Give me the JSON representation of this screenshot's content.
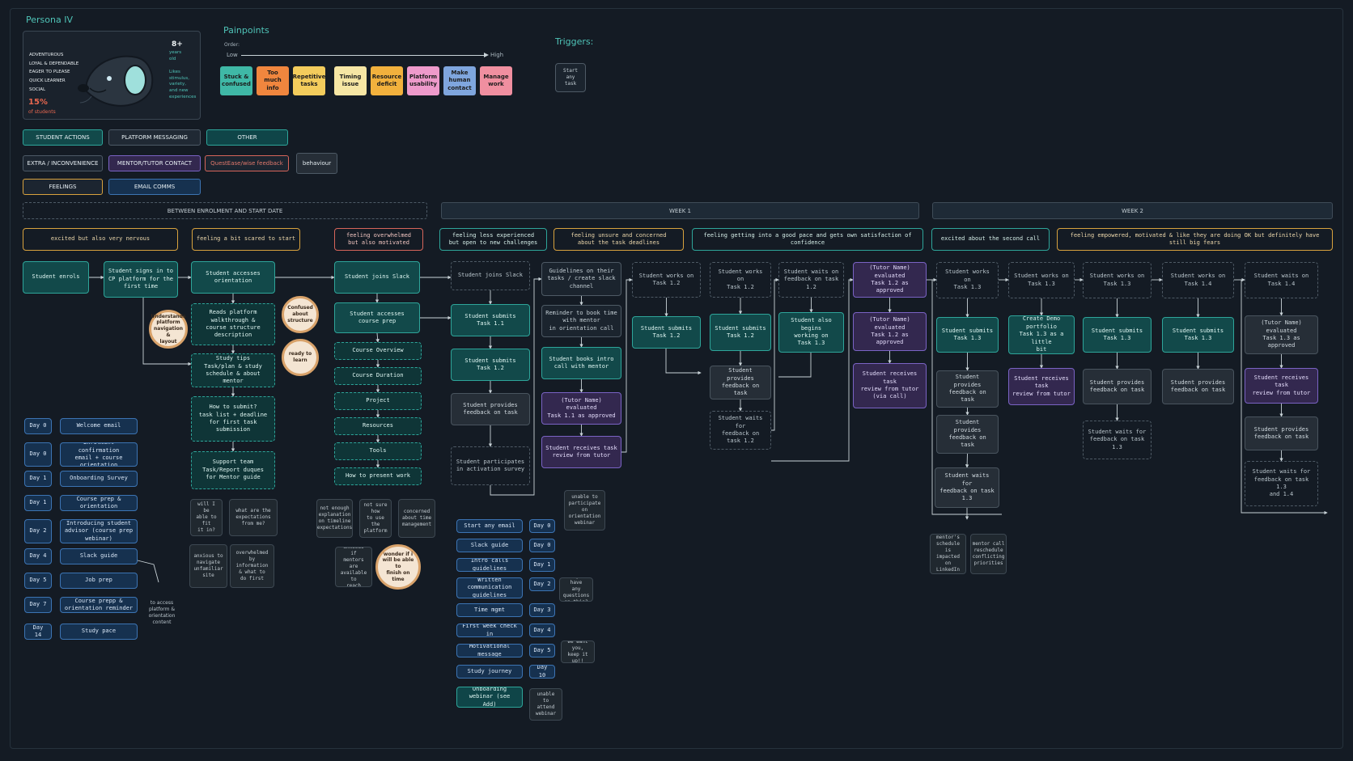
{
  "persona": {
    "title": "Persona IV",
    "traits": "ADVENTUROUS\nLOYAL & DEPENDABLE\nEAGER TO PLEASE\nQUICK LEARNER\nSOCIAL",
    "age_value": "8+",
    "age_label": "years\nold",
    "likes": "Likes\nstimulus,\nvariety,\nand new\nexperiences",
    "percent": "15%",
    "percent_label": "of students"
  },
  "painpoints": {
    "title": "Painpoints",
    "order_label": "Order:",
    "low": "Low",
    "high": "High",
    "items": [
      {
        "label": "Stuck &\nconfused",
        "color": "#3fb8a6"
      },
      {
        "label": "Too\nmuch\ninfo",
        "color": "#f0863e"
      },
      {
        "label": "Repetitive\ntasks",
        "color": "#f3cc5c"
      },
      {
        "label": "Timing\nissue",
        "color": "#f6e6a4"
      },
      {
        "label": "Resource\ndeficit",
        "color": "#f2b13d"
      },
      {
        "label": "Platform\nusability",
        "color": "#ee9acb"
      },
      {
        "label": "Make\nhuman\ncontact",
        "color": "#7fa6de"
      },
      {
        "label": "Manage\nwork",
        "color": "#f08fa0"
      }
    ]
  },
  "triggers": {
    "title": "Triggers:",
    "item": "Start\nany\ntask"
  },
  "legend": [
    {
      "label": "STUDENT ACTIONS",
      "bg": "#12494a",
      "border": "#2ea59a"
    },
    {
      "label": "PLATFORM MESSAGING",
      "bg": "#202934",
      "border": "#4d5a66"
    },
    {
      "label": "OTHER",
      "bg": "#0f4548",
      "border": "#2ea59a"
    },
    {
      "label": "EXTRA / INCONVENIENCE",
      "bg": "#1c2530",
      "border": "#4d5a66"
    },
    {
      "label": "MENTOR/TUTOR CONTACT",
      "bg": "#33284f",
      "border": "#7a63c4"
    },
    {
      "label": "QuestEase/wise feedback",
      "bg": "#1c2530",
      "border": "#d6655a"
    },
    {
      "label": "behaviour",
      "bg": "#262e37",
      "border": "#4d5a66"
    },
    {
      "label": "FEELINGS",
      "bg": "#1c2530",
      "border": "#d8a23e"
    },
    {
      "label": "EMAIL COMMS",
      "bg": "#16314f",
      "border": "#3c74b3"
    }
  ],
  "phases": [
    {
      "label": "BETWEEN ENROLMENT AND START DATE"
    },
    {
      "label": "WEEK 1"
    },
    {
      "label": "WEEK 2"
    }
  ],
  "feelings": [
    {
      "label": "excited but also very nervous",
      "tone": "f"
    },
    {
      "label": "feeling a bit scared to start",
      "tone": "f"
    },
    {
      "label": "feeling overwhelmed\nbut also motivated",
      "tone": "fr"
    },
    {
      "label": "feeling less experienced\nbut open to new challenges",
      "tone": "fg"
    },
    {
      "label": "feeling unsure and concerned\nabout the task deadlines",
      "tone": "f"
    },
    {
      "label": "feeling getting into a good pace and gets own satisfaction of confidence",
      "tone": "fg"
    },
    {
      "label": "excited about the second call",
      "tone": "fg"
    },
    {
      "label": "feeling empowered, motivated & like they are doing OK but definitely have still big fears",
      "tone": "f"
    }
  ],
  "nodes": [
    {
      "text": "Student enrols",
      "s": "g"
    },
    {
      "text": "Student signs in to\nCP platform for the\nfirst time",
      "s": "g"
    },
    {
      "text": "Student accesses\norientation",
      "s": "g"
    },
    {
      "text": "Reads platform\nwalkthrough &\ncourse structure\ndescription",
      "s": "gd"
    },
    {
      "text": "Study tips\nTask/plan & study\nschedule & about mentor",
      "s": "gd"
    },
    {
      "text": "How to submit?\ntask list + deadline\nfor first task\nsubmission",
      "s": "gd"
    },
    {
      "text": "Support team\nTask/Report duques\nfor Mentor guide",
      "s": "gd"
    },
    {
      "text": "Student joins Slack",
      "s": "g"
    },
    {
      "text": "Student accesses\ncourse prep",
      "s": "g"
    },
    {
      "text": "Course Overview",
      "s": "gd"
    },
    {
      "text": "Course Duration",
      "s": "gd"
    },
    {
      "text": "Project",
      "s": "gd"
    },
    {
      "text": "Resources",
      "s": "gd"
    },
    {
      "text": "Tools",
      "s": "gd"
    },
    {
      "text": "How to present work",
      "s": "gd"
    },
    {
      "text": "Student joins Slack",
      "s": "ph"
    },
    {
      "text": "Student submits\nTask 1.1",
      "s": "g"
    },
    {
      "text": "Student submits\nTask 1.2",
      "s": "g"
    },
    {
      "text": "Student provides\nfeedback on task",
      "s": "gr"
    },
    {
      "text": "Student participates\nin activation survey",
      "s": "ph"
    },
    {
      "text": "Guidelines on their\ntasks / create slack\nchannel",
      "s": "phs"
    },
    {
      "text": "Reminder to book time\nwith mentor\nin orientation call",
      "s": "phs"
    },
    {
      "text": "Student books intro\ncall with mentor",
      "s": "g"
    },
    {
      "text": "(Tutor Name) evaluated\nTask 1.1 as approved",
      "s": "p"
    },
    {
      "text": "Student receives task\nreview from tutor",
      "s": "p"
    },
    {
      "text": "Student works on\nTask 1.2",
      "s": "ph"
    },
    {
      "text": "Student submits\nTask 1.2",
      "s": "g"
    },
    {
      "text": "Student works on\nTask 1.2",
      "s": "ph"
    },
    {
      "text": "Student submits\nTask 1.2",
      "s": "g"
    },
    {
      "text": "Student provides\nfeedback on task",
      "s": "gr"
    },
    {
      "text": "Student waits for\nfeedback on task 1.2",
      "s": "ph"
    },
    {
      "text": "Student waits on\nfeedback on task 1.2",
      "s": "ph"
    },
    {
      "text": "Student also begins\nworking on\nTask 1.3",
      "s": "g"
    },
    {
      "text": "(Tutor Name) evaluated\nTask 1.2 as approved",
      "s": "p"
    },
    {
      "text": "(Tutor Name) evaluated\nTask 1.2 as approved",
      "s": "p"
    },
    {
      "text": "Student receives task\nreview from tutor\n(via call)",
      "s": "p"
    },
    {
      "text": "Student works on\nTask 1.3",
      "s": "ph"
    },
    {
      "text": "Student submits\nTask 1.3",
      "s": "g"
    },
    {
      "text": "Student provides\nfeedback on task",
      "s": "gr"
    },
    {
      "text": "Student provides\nfeedback on task",
      "s": "gr"
    },
    {
      "text": "Student waits for\nfeedback on task 1.3",
      "s": "gr"
    },
    {
      "text": "Student works on\nTask 1.3",
      "s": "ph"
    },
    {
      "text": "Create Demo portfolio\nTask 1.3 as a little\nbit",
      "s": "g"
    },
    {
      "text": "Student receives task\nreview from tutor",
      "s": "p"
    },
    {
      "text": "Student works on\nTask 1.3",
      "s": "ph"
    },
    {
      "text": "Student submits\nTask 1.3",
      "s": "g"
    },
    {
      "text": "Student provides\nfeedback on task",
      "s": "gr"
    },
    {
      "text": "Student waits for\nfeedback on task 1.3",
      "s": "ph"
    },
    {
      "text": "Student works on\nTask 1.4",
      "s": "ph"
    },
    {
      "text": "Student submits\nTask 1.3",
      "s": "g"
    },
    {
      "text": "Student provides\nfeedback on task",
      "s": "gr"
    },
    {
      "text": "Student waits on\nTask 1.4",
      "s": "ph"
    },
    {
      "text": "(Tutor Name) evaluated\nTask 1.3 as approved",
      "s": "gr"
    },
    {
      "text": "Student receives task\nreview from tutor",
      "s": "p"
    },
    {
      "text": "Student provides\nfeedback on task",
      "s": "gr"
    },
    {
      "text": "Student waits for\nfeedback on task 1.3\nand 1.4",
      "s": "ph"
    }
  ],
  "bubbles": [
    {
      "text": "Understands\nplatform\nnavigation &\nlayout"
    },
    {
      "text": "Confused\nabout\nstructure"
    },
    {
      "text": "ready to\nlearn"
    },
    {
      "text": "wonder if i\nwill be able to\nfinish on\ntime"
    }
  ],
  "thoughts": [
    {
      "text": "will I be\nable to fit\nit in?"
    },
    {
      "text": "what are the\nexpectations\nfrom me?"
    },
    {
      "text": "anxious to\nnavigate\nunfamiliar\nsite"
    },
    {
      "text": "overwhelmed\nby information\n& what to\ndo first"
    },
    {
      "text": "not enough\nexplanation\non timeline\nexpectations"
    },
    {
      "text": "not sure how\nto use the\nplatform"
    },
    {
      "text": "concerned\nabout time\nmanagement"
    },
    {
      "text": "anxious if\nmentors are\navailable to\nreach"
    },
    {
      "text": "unable to\nparticipate on\norientation\nwebinar"
    },
    {
      "text": "do you have\nany questions\non this?"
    },
    {
      "text": "we want\nyou, keep it\nup!!"
    },
    {
      "text": "unable to\nattend\nwebinar"
    },
    {
      "text": "mentor's\nschedule\nis impacted\non LinkedIn"
    },
    {
      "text": "mentor call\nreschedule\nconflicting\npriorities"
    }
  ],
  "email_comms": [
    {
      "day": "Day 0",
      "label": "Welcome email"
    },
    {
      "day": "Day 0",
      "label": "Enrolment confirmation\nemail + course\norientation"
    },
    {
      "day": "Day 1",
      "label": "Onboarding Survey"
    },
    {
      "day": "Day 1",
      "label": "Course prep &\norientation"
    },
    {
      "day": "Day 2",
      "label": "Introducing student\nadvisor (course prep\nwebinar)"
    },
    {
      "day": "Day 4",
      "label": "Slack guide"
    },
    {
      "day": "Day 5",
      "label": "Job prep"
    },
    {
      "day": "Day 7",
      "label": "Course prepp &\norientation reminder"
    },
    {
      "day": "Day 14",
      "label": "Study pace"
    }
  ],
  "email_note": "to access\nplatform &\norientation\ncontent",
  "platform_msgs": [
    {
      "label": "Start any email",
      "day": "Day 0"
    },
    {
      "label": "Slack guide",
      "day": "Day 0"
    },
    {
      "label": "Intro calls guidelines",
      "day": "Day 1"
    },
    {
      "label": "Written communication\nguidelines",
      "day": "Day 2"
    },
    {
      "label": "Time mgmt",
      "day": "Day 3"
    },
    {
      "label": "First week check in",
      "day": "Day 4"
    },
    {
      "label": "Motivational message",
      "day": "Day 5"
    },
    {
      "label": "Study journey",
      "day": "Day 10"
    },
    {
      "label": "Onboarding webinar (see\nAdd)",
      "day": ""
    }
  ]
}
